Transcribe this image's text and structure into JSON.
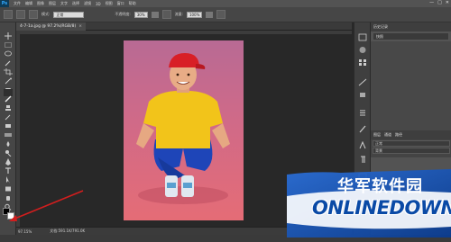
{
  "menubar": {
    "logo": "Ps",
    "items": [
      "文件",
      "编辑",
      "图像",
      "图层",
      "文字",
      "选择",
      "滤镜",
      "3D",
      "视图",
      "窗口",
      "帮助"
    ],
    "window_controls": [
      "—",
      "□",
      "✕"
    ]
  },
  "options": {
    "mode_label": "模式:",
    "mode_value": "正常",
    "opacity_label": "不透明度:",
    "opacity_value": "30%",
    "flow_label": "流量:",
    "flow_value": "100%"
  },
  "document": {
    "tab_title": "4-7-1a.jpg @ 97.2%(RGB/8)",
    "close_glyph": "×"
  },
  "status": {
    "zoom": "97.15%",
    "doc_size": "文档:591.1K/791.0K"
  },
  "panels": {
    "history_tab": "历史记录",
    "history_item": "快照",
    "layers_tabs": [
      "图层",
      "通道",
      "路径"
    ],
    "blend_mode": "正常",
    "layer_name": "背景"
  },
  "watermark": {
    "cn": "华军软件园",
    "en": "ONLINEDOWN.NET"
  },
  "colors": {
    "accent_arrow": "#d21e1e",
    "watermark_blue": "#0a4aa6",
    "photo_bg": "#e0607a"
  }
}
